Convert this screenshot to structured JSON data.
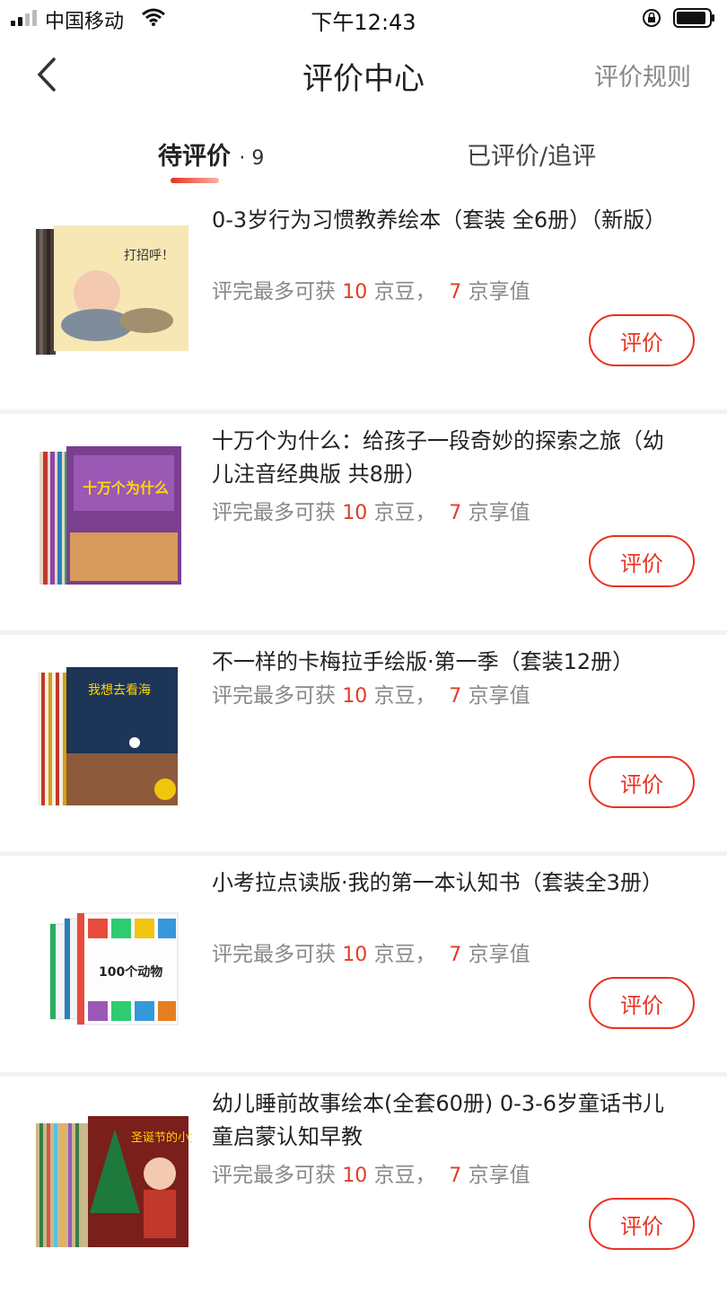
{
  "status_bar": {
    "carrier": "中国移动",
    "time": "下午12:43"
  },
  "nav": {
    "title": "评价中心",
    "rules_link": "评价规则"
  },
  "tabs": {
    "pending_label": "待评价",
    "pending_count": "· 9",
    "done_label": "已评价/追评"
  },
  "reward_text": {
    "prefix": "评完最多可获",
    "beans_num": "10",
    "beans_unit": "京豆，",
    "value_num": "7",
    "value_unit": "京享值"
  },
  "items": [
    {
      "title": "0-3岁行为习惯教养绘本（套装 全6册）（新版）",
      "button": "评价"
    },
    {
      "title": "十万个为什么：给孩子一段奇妙的探索之旅（幼儿注音经典版 共8册）",
      "button": "评价"
    },
    {
      "title": "不一样的卡梅拉手绘版·第一季（套装12册）",
      "button": "评价"
    },
    {
      "title": "小考拉点读版·我的第一本认知书（套装全3册）",
      "button": "评价"
    },
    {
      "title": "幼儿睡前故事绘本(全套60册) 0-3-6岁童话书儿童启蒙认知早教",
      "button": "评价"
    }
  ],
  "covers": [
    {
      "text": "打招呼！"
    },
    {
      "text": "十万个为什么"
    },
    {
      "text": "我想去看海"
    },
    {
      "text": "100个动物"
    },
    {
      "text": "圣诞节的小女孩"
    }
  ],
  "colors": {
    "accent": "#e9321f",
    "number": "#e33c23"
  }
}
